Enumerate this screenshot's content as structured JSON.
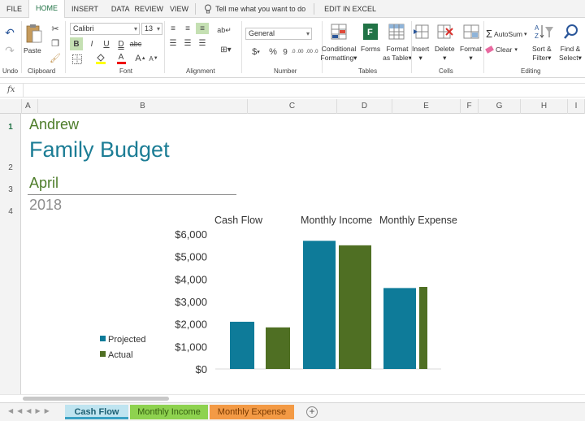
{
  "ribbon_tabs": [
    "FILE",
    "HOME",
    "INSERT",
    "DATA",
    "REVIEW",
    "VIEW"
  ],
  "active_tab": "HOME",
  "tell_me": "Tell me what you want to do",
  "edit_in_excel": "EDIT IN EXCEL",
  "ribbon": {
    "undo": "Undo",
    "paste": "Paste",
    "clipboard": "Clipboard",
    "font_name": "Calibri",
    "font_size": "13",
    "bold": "B",
    "italic": "I",
    "underline": "U",
    "double_underline": "D",
    "strike": "abc",
    "font_color_letter": "A",
    "grow_font": "A",
    "shrink_font": "A",
    "font_group": "Font",
    "alignment_group": "Alignment",
    "number_format": "General",
    "currency": "$",
    "percent": "%",
    "comma": "9",
    "dec_increase": ".0 .00",
    "dec_decrease": ".00 .0",
    "number_group": "Number",
    "conditional_formatting": [
      "Conditional",
      "Formatting"
    ],
    "forms": "Forms",
    "format_as_table": [
      "Format",
      "as Table"
    ],
    "tables_group": "Tables",
    "insert": "Insert",
    "delete": "Delete",
    "format": "Format",
    "cells_group": "Cells",
    "autosum": "AutoSum",
    "clear": "Clear",
    "sort_filter": [
      "Sort &",
      "Filter"
    ],
    "find_select": [
      "Find &",
      "Select"
    ],
    "editing_group": "Editing"
  },
  "formula_bar": {
    "fx": "fx",
    "value": ""
  },
  "columns": [
    "A",
    "B",
    "C",
    "D",
    "E",
    "F",
    "G",
    "H",
    "I"
  ],
  "rows": [
    "1",
    "2",
    "3",
    "4"
  ],
  "sheet": {
    "name": "Andrew",
    "title": "Family Budget",
    "month": "April",
    "year": "2018"
  },
  "colors": {
    "projected": "#0e7b99",
    "actual": "#4f6f23",
    "accent": "#217346"
  },
  "chart_data": {
    "type": "bar",
    "categories": [
      "Cash Flow",
      "Monthly Income",
      "Monthly Expense"
    ],
    "series": [
      {
        "name": "Projected",
        "values": [
          2100,
          5700,
          3600
        ]
      },
      {
        "name": "Actual",
        "values": [
          1850,
          5500,
          3650
        ]
      }
    ],
    "ylim": [
      0,
      6000
    ],
    "yticks": [
      "$0",
      "$1,000",
      "$2,000",
      "$3,000",
      "$4,000",
      "$5,000",
      "$6,000"
    ],
    "legend": "bottom-left",
    "grid": false
  },
  "sheet_tabs": [
    {
      "label": "Cash Flow",
      "active": true,
      "color": "#9bd4e6",
      "text": "#1c5f73"
    },
    {
      "label": "Monthly Income",
      "active": false,
      "color": "#8ed24f",
      "text": "#355e10"
    },
    {
      "label": "Monthly Expense",
      "active": false,
      "color": "#f39a45",
      "text": "#7a3a00"
    }
  ],
  "add_sheet": "+"
}
